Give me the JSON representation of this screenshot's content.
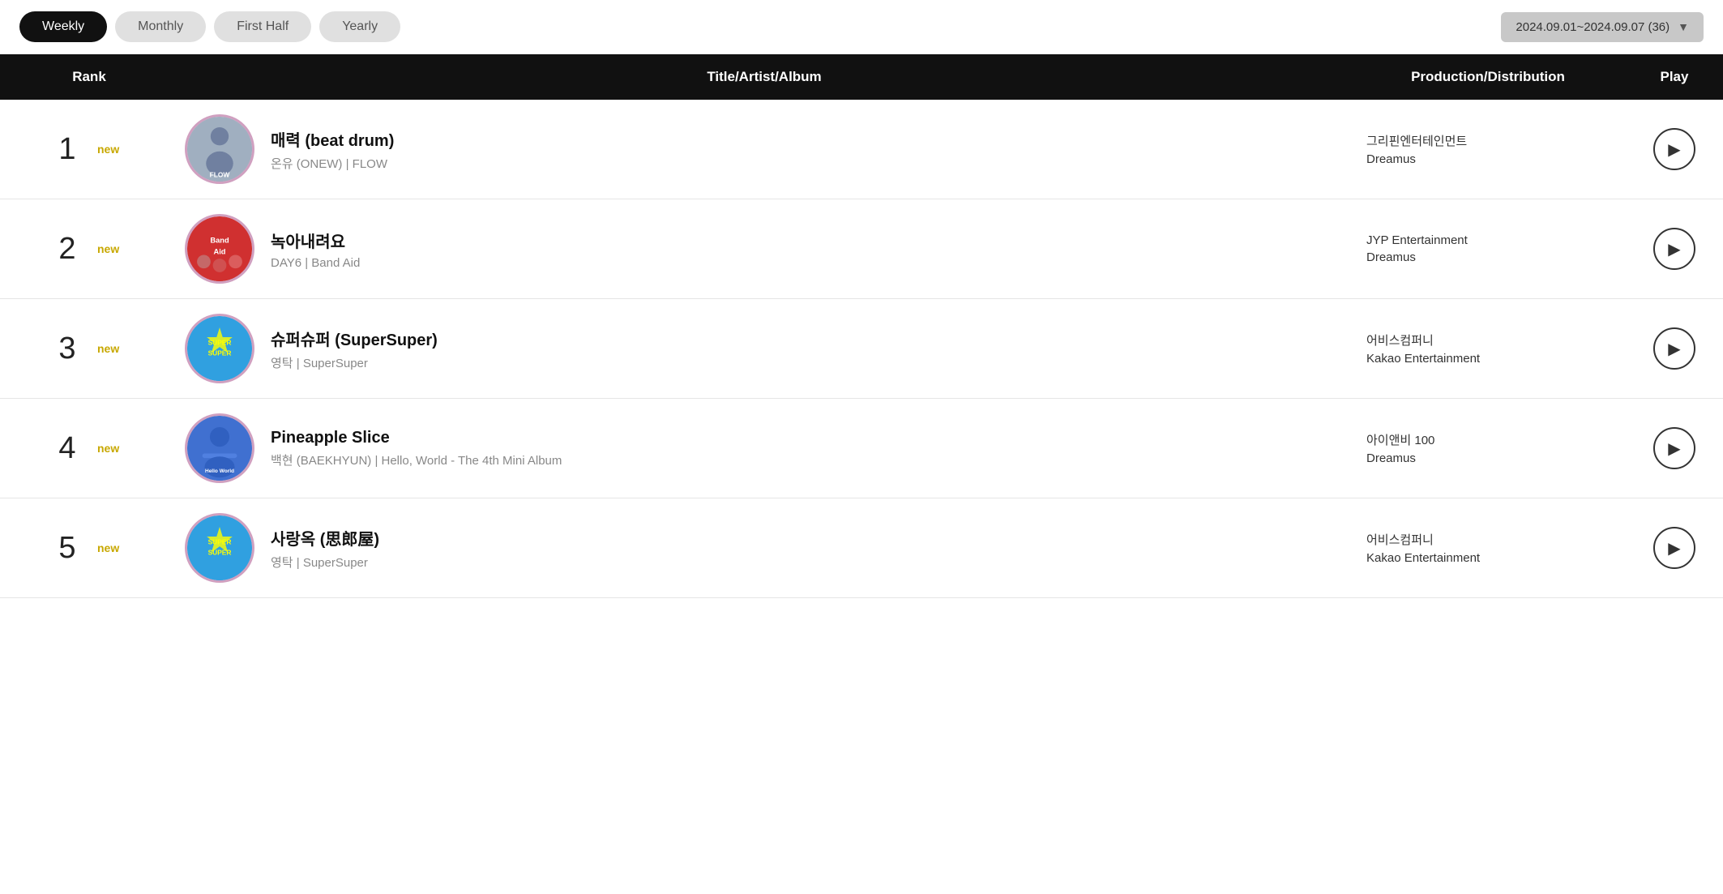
{
  "tabs": [
    {
      "id": "weekly",
      "label": "Weekly",
      "active": true
    },
    {
      "id": "monthly",
      "label": "Monthly",
      "active": false
    },
    {
      "id": "first-half",
      "label": "First Half",
      "active": false
    },
    {
      "id": "yearly",
      "label": "Yearly",
      "active": false
    }
  ],
  "dateRange": {
    "label": "2024.09.01~2024.09.07 (36)",
    "chevron": "▼"
  },
  "tableHeaders": {
    "rank": "Rank",
    "title": "Title/Artist/Album",
    "production": "Production/Distribution",
    "play": "Play"
  },
  "rows": [
    {
      "rank": "1",
      "badge": "new",
      "artClass": "art-1",
      "artLabel": "FLOW",
      "title": "매력 (beat drum)",
      "subtitle": "온유 (ONEW) | FLOW",
      "production": "그리핀엔터테인먼트",
      "distribution": "Dreamus"
    },
    {
      "rank": "2",
      "badge": "new",
      "artClass": "art-2",
      "artLabel": "Band Aid",
      "title": "녹아내려요",
      "subtitle": "DAY6 | Band Aid",
      "production": "JYP Entertainment",
      "distribution": "Dreamus"
    },
    {
      "rank": "3",
      "badge": "new",
      "artClass": "art-3",
      "artLabel": "SuperSuper",
      "title": "슈퍼슈퍼 (SuperSuper)",
      "subtitle": "영탁 | SuperSuper",
      "production": "어비스컴퍼니",
      "distribution": "Kakao Entertainment"
    },
    {
      "rank": "4",
      "badge": "new",
      "artClass": "art-4",
      "artLabel": "Hello World",
      "title": "Pineapple Slice",
      "subtitle": "백현 (BAEKHYUN) | Hello, World - The 4th Mini Album",
      "production": "아이앤비 100",
      "distribution": "Dreamus"
    },
    {
      "rank": "5",
      "badge": "new",
      "artClass": "art-5",
      "artLabel": "SuperSuper",
      "title": "사랑옥 (思郎屋)",
      "subtitle": "영탁 | SuperSuper",
      "production": "어비스컴퍼니",
      "distribution": "Kakao Entertainment"
    }
  ]
}
